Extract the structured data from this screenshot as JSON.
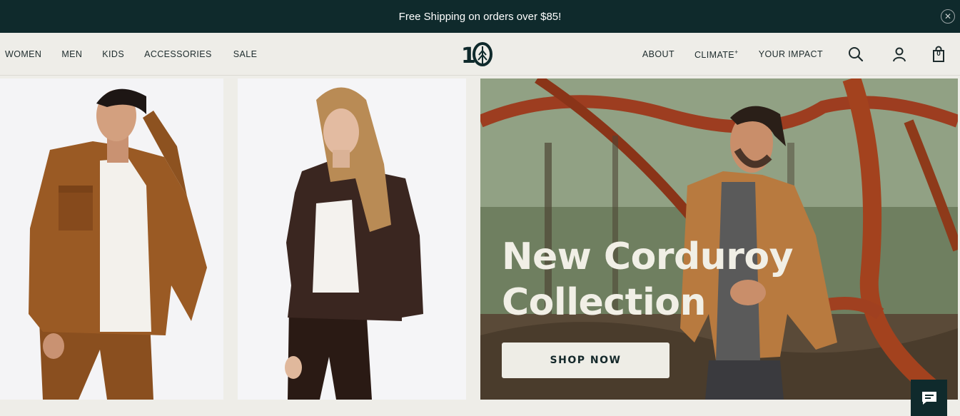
{
  "announcement": {
    "text": "Free Shipping on orders over $85!"
  },
  "nav": {
    "left": [
      {
        "label": "WOMEN"
      },
      {
        "label": "MEN"
      },
      {
        "label": "KIDS"
      },
      {
        "label": "ACCESSORIES"
      },
      {
        "label": "SALE"
      }
    ],
    "right": [
      {
        "label": "ABOUT"
      },
      {
        "label": "CLIMATE"
      },
      {
        "label": "YOUR IMPACT"
      }
    ],
    "climate_suffix": "+",
    "logo_text": "10",
    "cart_count": "0"
  },
  "hero": {
    "title_line1": "New Corduroy",
    "title_line2": "Collection",
    "cta_label": "SHOP NOW"
  },
  "colors": {
    "announce_bg": "#0f2a2c",
    "page_bg": "#eeede8",
    "button_bg": "#eeede6",
    "text_dark": "#1d2b2c"
  },
  "icons": [
    "close-icon",
    "tree-logo-icon",
    "search-icon",
    "account-icon",
    "cart-icon",
    "chat-icon"
  ]
}
